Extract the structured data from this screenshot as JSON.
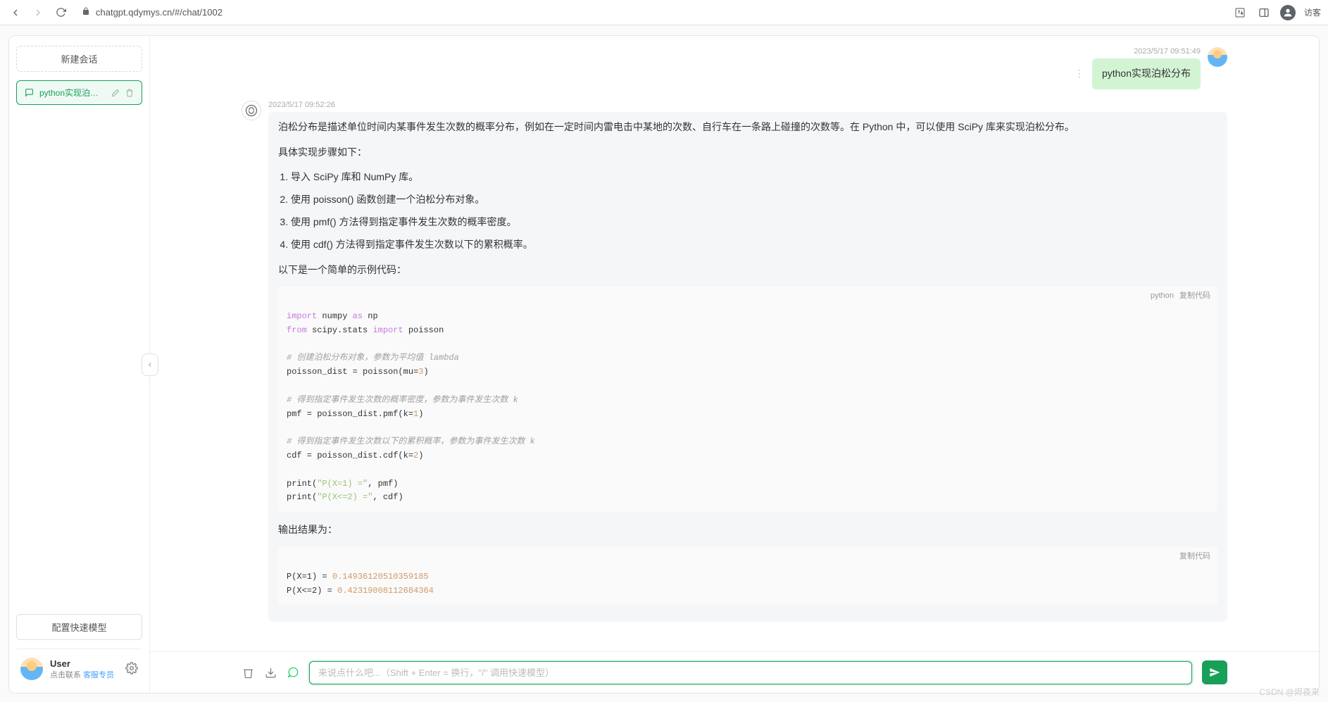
{
  "browser": {
    "url": "chatgpt.qdymys.cn/#/chat/1002",
    "visitor": "访客"
  },
  "sidebar": {
    "new_chat": "新建会话",
    "session": {
      "title": "python实现泊松分布"
    },
    "quick_model": "配置快速模型",
    "user": {
      "name": "User",
      "contact_prefix": "点击联系 ",
      "contact_link": "客服专员"
    }
  },
  "messages": {
    "user": {
      "time": "2023/5/17 09:51:49",
      "text": "python实现泊松分布"
    },
    "bot": {
      "time": "2023/5/17 09:52:26",
      "p_intro": "泊松分布是描述单位时间内某事件发生次数的概率分布，例如在一定时间内雷电击中某地的次数、自行车在一条路上碰撞的次数等。在 Python 中，可以使用 SciPy 库来实现泊松分布。",
      "p_steps_label": "具体实现步骤如下：",
      "steps": [
        "导入 SciPy 库和 NumPy 库。",
        "使用 poisson() 函数创建一个泊松分布对象。",
        "使用 pmf() 方法得到指定事件发生次数的概率密度。",
        "使用 cdf() 方法得到指定事件发生次数以下的累积概率。"
      ],
      "p_example_label": "以下是一个简单的示例代码：",
      "code1": {
        "lang": "python",
        "copy": "复制代码",
        "l1a": "import",
        "l1b": " numpy ",
        "l1c": "as",
        "l1d": " np",
        "l2a": "from",
        "l2b": " scipy.stats ",
        "l2c": "import",
        "l2d": " poisson",
        "c1": "# 创建泊松分布对象，参数为平均值 lambda",
        "l3": "poisson_dist = poisson(mu=",
        "l3n": "3",
        "l3e": ")",
        "c2": "# 得到指定事件发生次数的概率密度，参数为事件发生次数 k",
        "l4": "pmf = poisson_dist.pmf(k=",
        "l4n": "1",
        "l4e": ")",
        "c3": "# 得到指定事件发生次数以下的累积概率，参数为事件发生次数 k",
        "l5": "cdf = poisson_dist.cdf(k=",
        "l5n": "2",
        "l5e": ")",
        "l6a": "print",
        "l6b": "(",
        "l6s": "\"P(X=1) =\"",
        "l6c": ", pmf)",
        "l7a": "print",
        "l7b": "(",
        "l7s": "\"P(X<=2) =\"",
        "l7c": ", cdf)"
      },
      "p_output_label": "输出结果为：",
      "code2": {
        "copy": "复制代码",
        "l1": "P(X=1) = ",
        "l1n": "0.14936120510359185",
        "l2": "P(X<=2) = ",
        "l2n": "0.42319008112684364"
      }
    }
  },
  "composer": {
    "placeholder": "来说点什么吧...（Shift + Enter = 换行，\"/\" 调用快速模型）"
  },
  "watermark": "CSDN @烬夜来"
}
